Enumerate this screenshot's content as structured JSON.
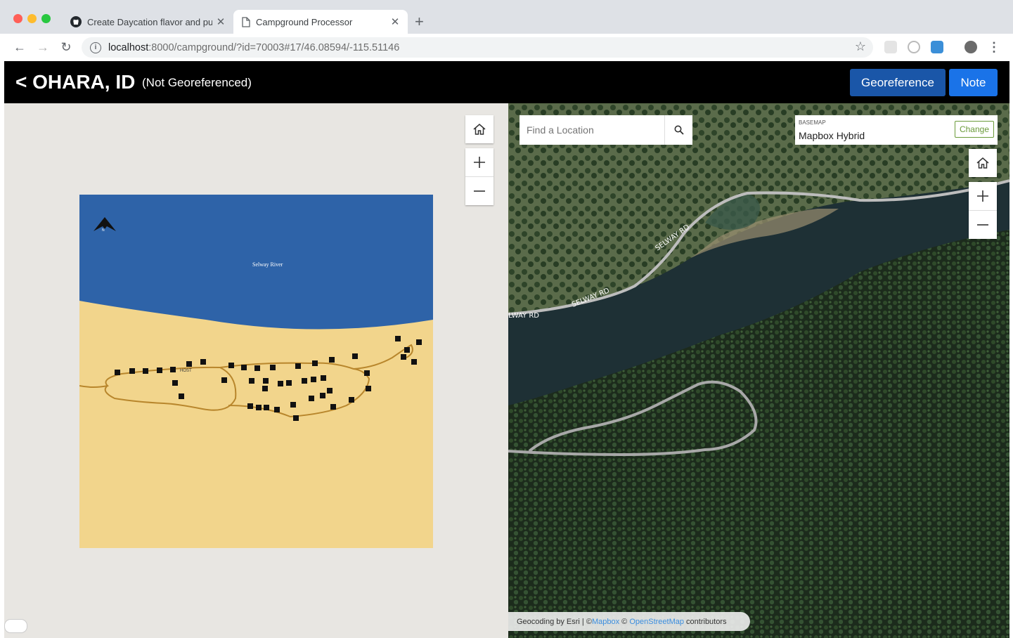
{
  "browser": {
    "tabs": [
      {
        "title": "Create Daycation flavor and pu",
        "icon": "github-icon",
        "active": false
      },
      {
        "title": "Campground Processor",
        "icon": "document-icon",
        "active": true
      }
    ],
    "url_host": "localhost",
    "url_path": ":8000/campground/?id=70003#17/46.08594/-115.51146"
  },
  "app": {
    "back_title": "< OHARA, ID",
    "status": "(Not Georeferenced)",
    "georeference_label": "Georeference",
    "note_label": "Note",
    "colors": {
      "georeference": "#1a56a8",
      "note": "#1a73e8",
      "water": "#2e63a8",
      "land": "#f2d58c",
      "road": "#b8862c"
    }
  },
  "image_map": {
    "river_label": "Selway River",
    "host_label": "HOST",
    "north_label": "N"
  },
  "map": {
    "search_placeholder": "Find a Location",
    "basemap_label": "BASEMAP",
    "basemap_name": "Mapbox Hybrid",
    "change_label": "Change",
    "road_labels": [
      "SELWAY RD",
      "SELWAY RD",
      "LWAY RD"
    ],
    "attribution": {
      "prefix": "Geocoding by Esri | © ",
      "mapbox": "Mapbox",
      "mid": " © ",
      "osm": "OpenStreetMap",
      "suffix": " contributors"
    }
  }
}
